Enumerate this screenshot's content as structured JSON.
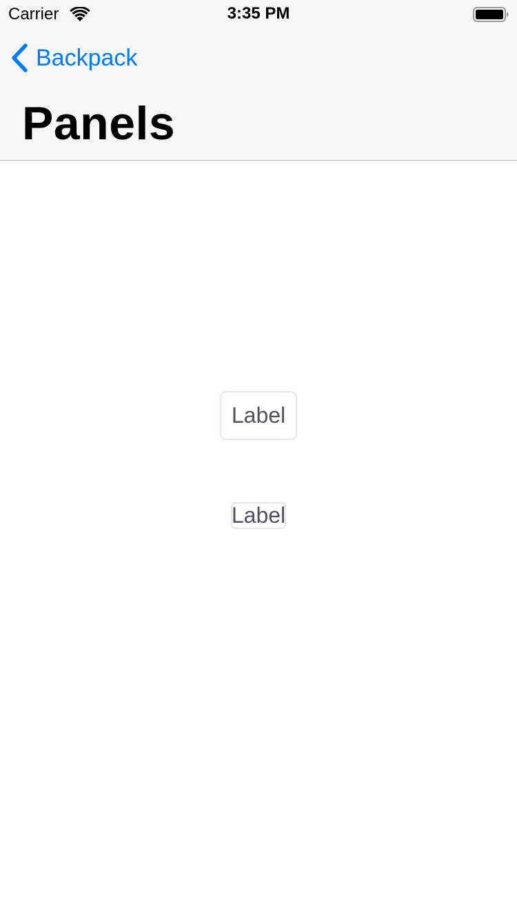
{
  "status_bar": {
    "carrier": "Carrier",
    "time": "3:35 PM",
    "wifi_icon": "wifi-icon",
    "battery_icon": "battery-icon"
  },
  "nav": {
    "back_label": "Backpack",
    "back_icon": "chevron-left-icon",
    "title": "Panels"
  },
  "panels": [
    {
      "label": "Label",
      "style": "padded"
    },
    {
      "label": "Label",
      "style": "unpadded"
    }
  ],
  "colors": {
    "accent": "#007aff",
    "nav_background": "#f7f7f7",
    "panel_border": "#e6e6e6",
    "panel_text": "#50505f",
    "hairline": "#b2b2b2"
  }
}
